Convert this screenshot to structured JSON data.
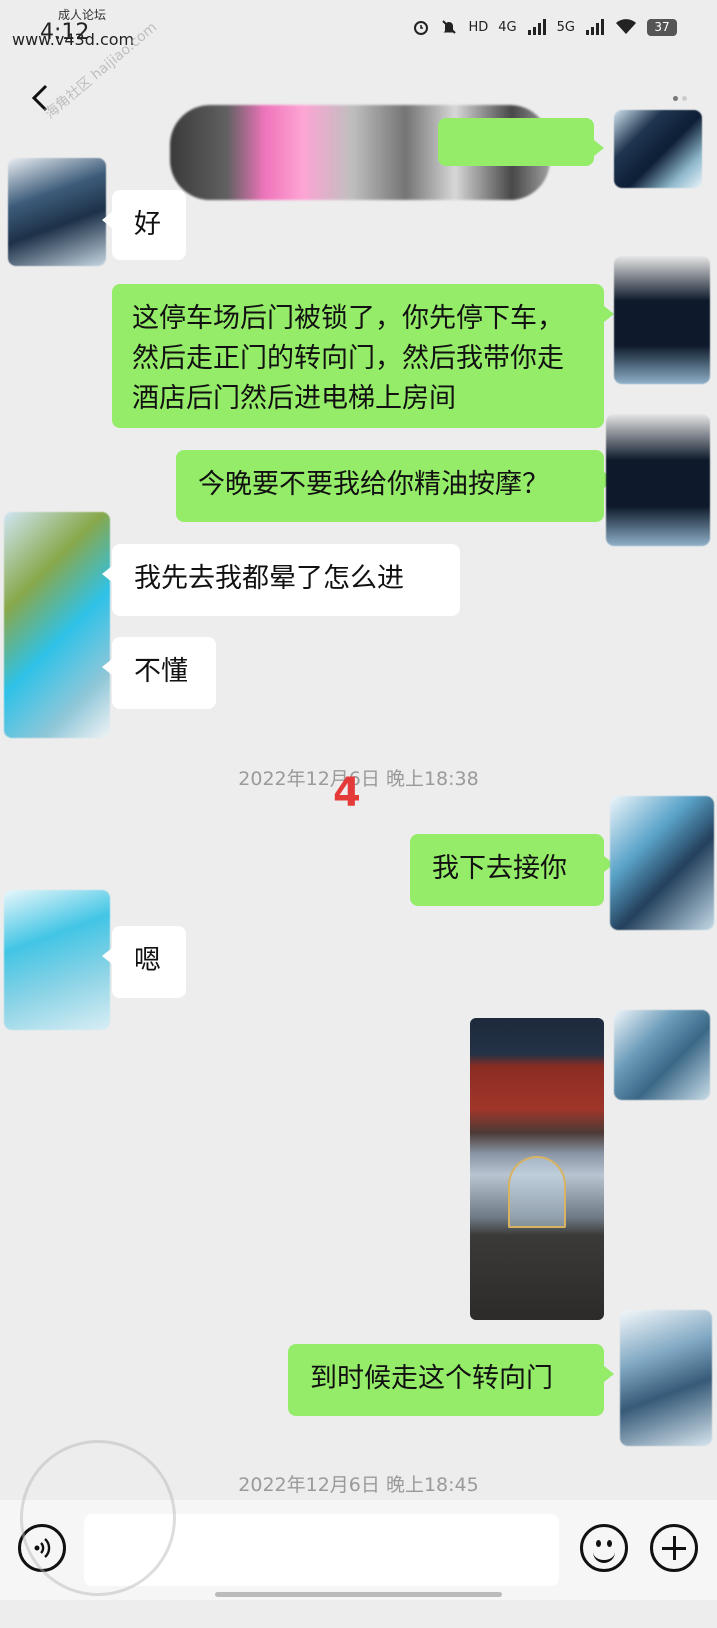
{
  "status_bar": {
    "time": "4:12",
    "network": [
      "HD",
      "4G",
      "5G"
    ],
    "battery": "37",
    "watermark_top": "成人论坛",
    "watermark_site": "www.v43d.com"
  },
  "header": {
    "back_icon": "chevron-left-icon",
    "more_icon": "more-dots-icon"
  },
  "messages": [
    {
      "side": "left",
      "text": "好"
    },
    {
      "side": "right",
      "text": "这停车场后门被锁了，你先停下车，然后走正门的转向门，然后我带你走酒店后门然后进电梯上房间"
    },
    {
      "side": "right",
      "text": "今晚要不要我给你精油按摩？"
    },
    {
      "side": "left",
      "text": "我先去我都晕了怎么进"
    },
    {
      "side": "left",
      "text": "不懂"
    },
    {
      "side": "right",
      "text": "我下去接你"
    },
    {
      "side": "left",
      "text": "嗯"
    },
    {
      "side": "right",
      "text": "到时候走这个转向门"
    }
  ],
  "timestamps": [
    "2022年12月6日 晚上18:38",
    "2022年12月6日 晚上18:45"
  ],
  "annotation": "4",
  "bottom_bar": {
    "voice_icon": "voice-icon",
    "emoji_icon": "emoji-icon",
    "plus_icon": "plus-icon"
  },
  "watermark_stamp": "海角社区 haijiao.com",
  "colors": {
    "background": "#ededed",
    "incoming_bubble": "#ffffff",
    "outgoing_bubble": "#95ec69"
  }
}
